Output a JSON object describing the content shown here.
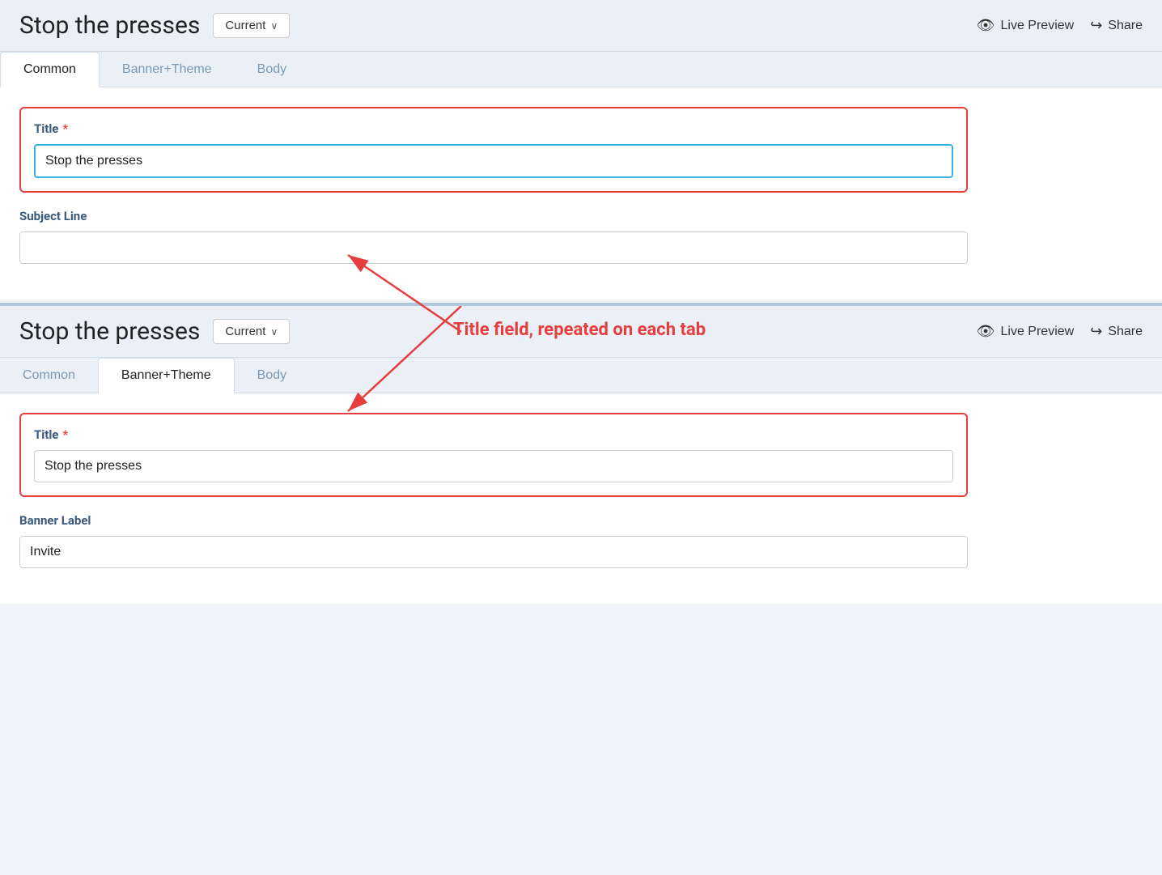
{
  "panel1": {
    "title": "Stop the presses",
    "version_label": "Current",
    "live_preview_label": "Live Preview",
    "share_label": "Share",
    "tabs": [
      {
        "label": "Common",
        "active": true
      },
      {
        "label": "Banner+Theme",
        "active": false
      },
      {
        "label": "Body",
        "active": false
      }
    ],
    "title_field": {
      "label": "Title",
      "required": true,
      "value": "Stop the presses",
      "focused": true
    },
    "subject_line_field": {
      "label": "Subject Line",
      "value": ""
    }
  },
  "panel2": {
    "title": "Stop the presses",
    "version_label": "Current",
    "live_preview_label": "Live Preview",
    "share_label": "Share",
    "tabs": [
      {
        "label": "Common",
        "active": false
      },
      {
        "label": "Banner+Theme",
        "active": true
      },
      {
        "label": "Body",
        "active": false
      }
    ],
    "title_field": {
      "label": "Title",
      "required": true,
      "value": "Stop the presses"
    },
    "banner_label_field": {
      "label": "Banner Label",
      "value": "Invite"
    }
  },
  "annotation": {
    "text": "Title field, repeated on each tab"
  },
  "icons": {
    "eye": "👁",
    "share": "↪",
    "chevron_down": "∨"
  }
}
